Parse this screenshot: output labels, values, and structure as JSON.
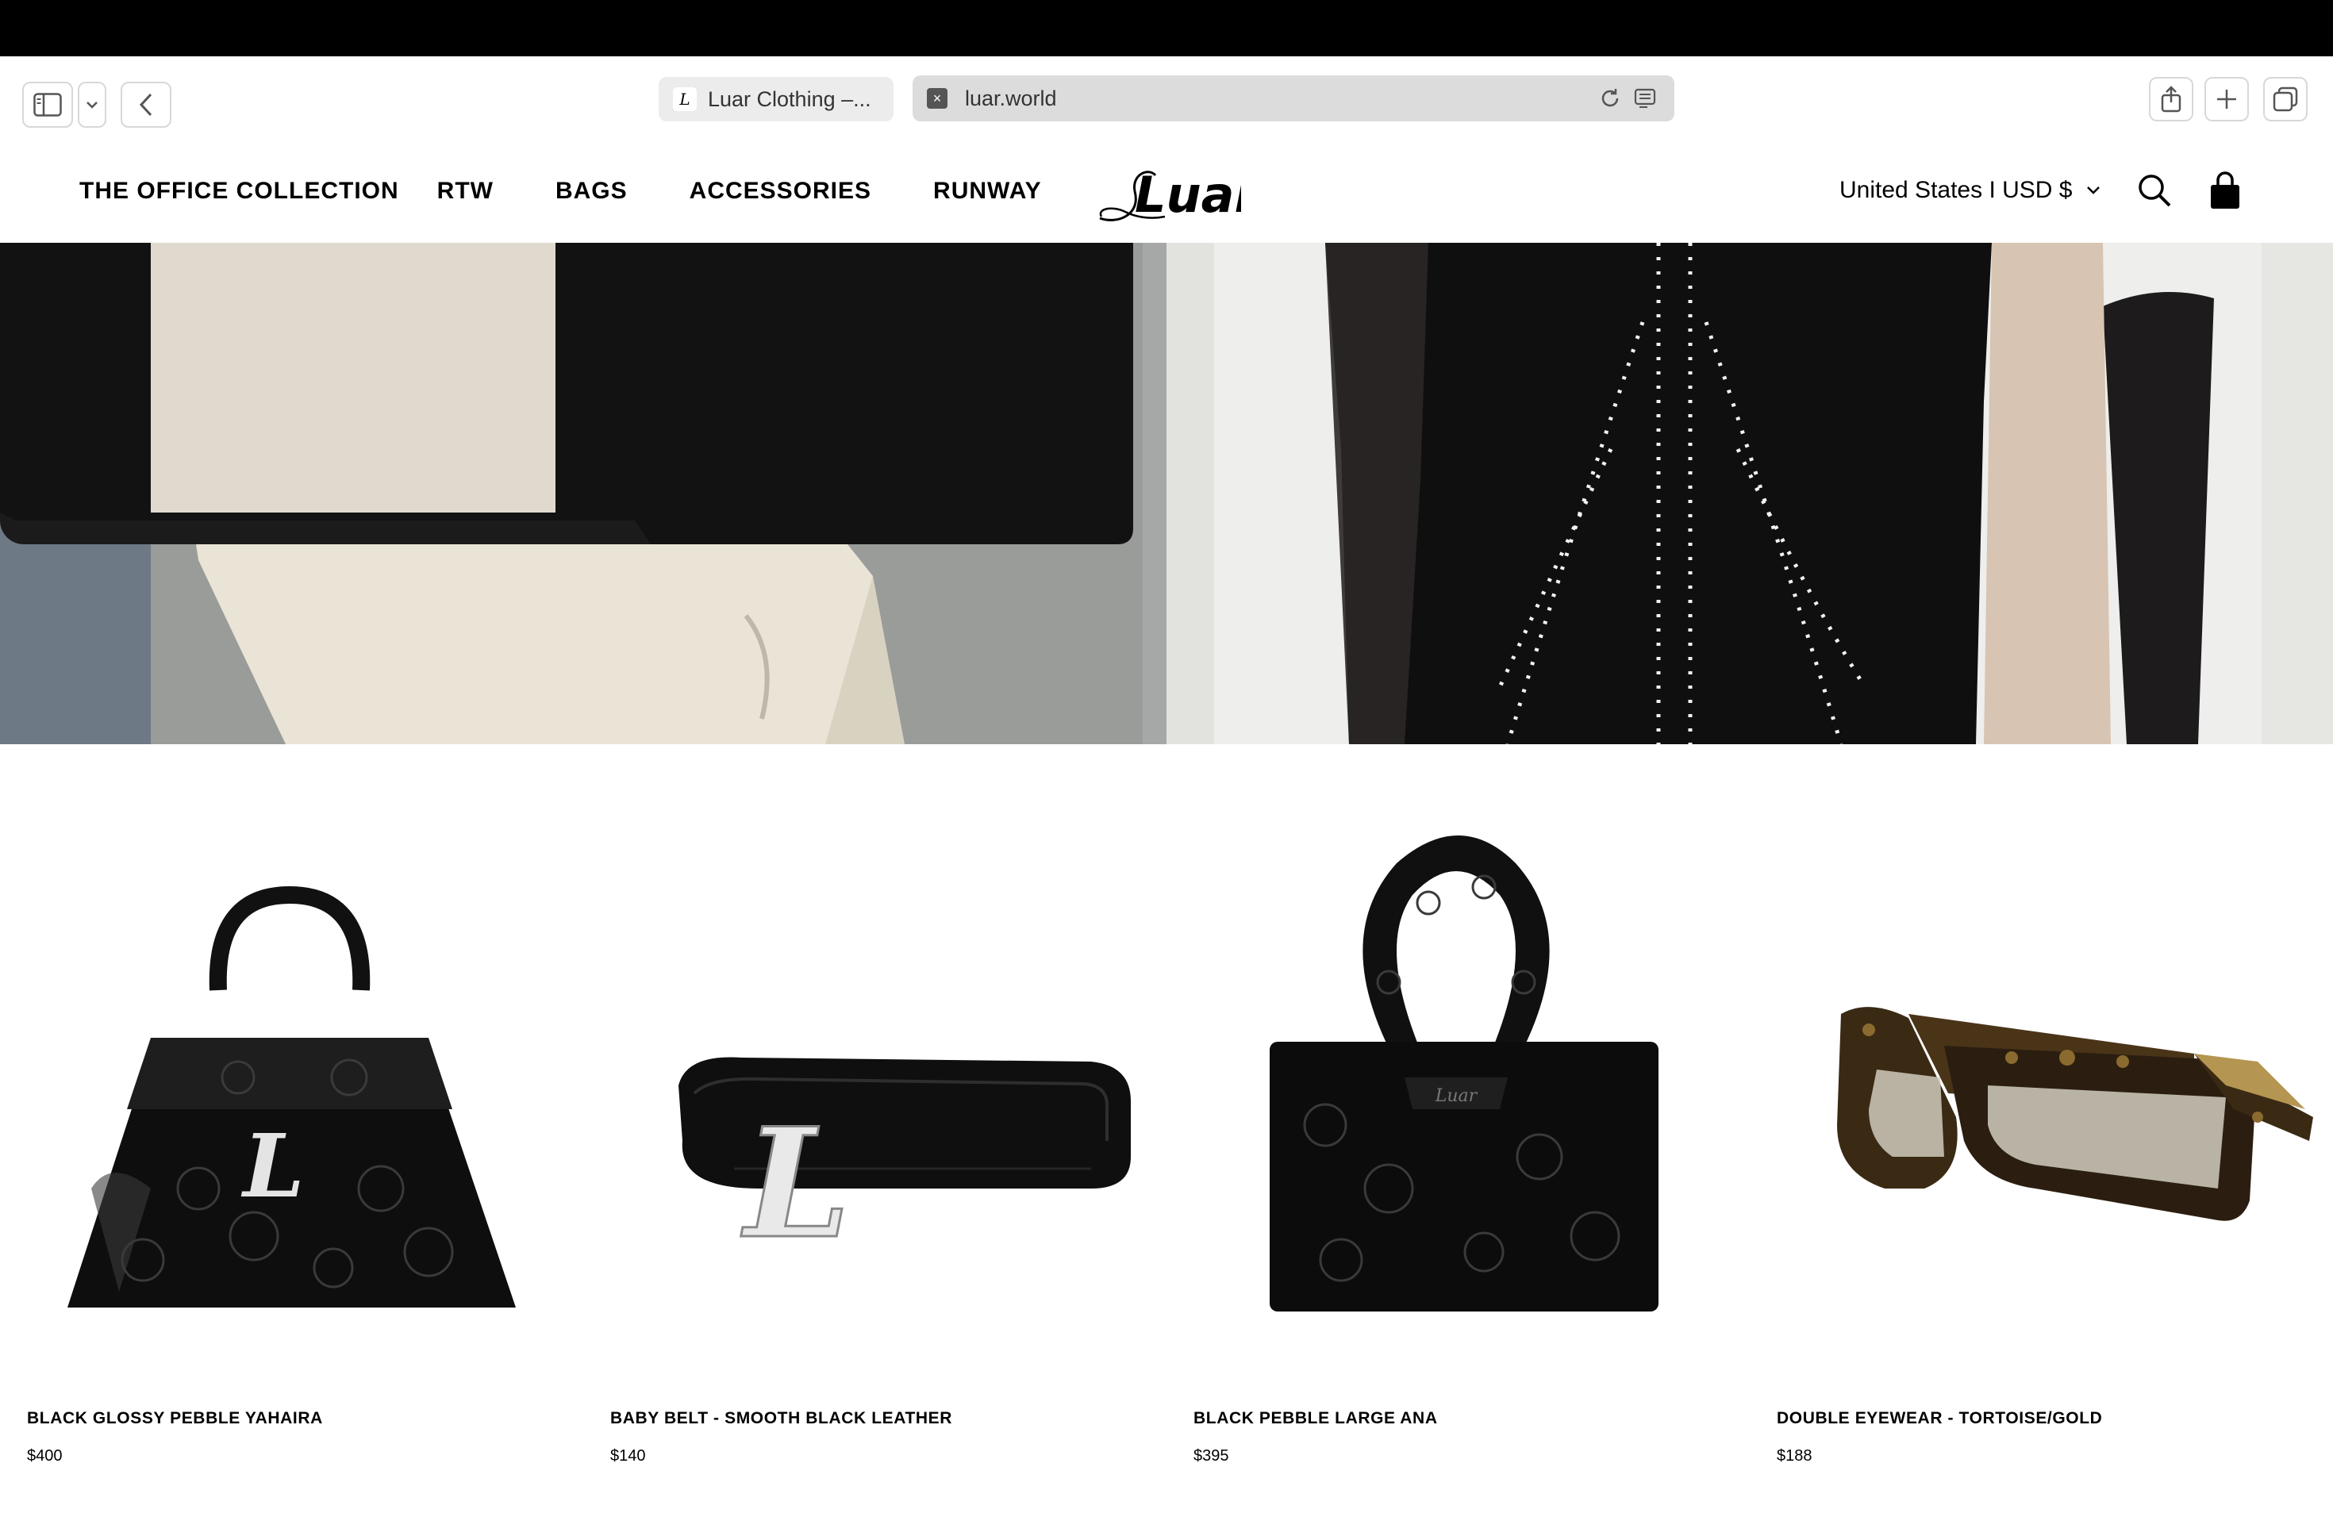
{
  "browser": {
    "tab_title": "Luar Clothing –...",
    "url": "luar.world"
  },
  "nav": {
    "items": [
      "THE OFFICE COLLECTION",
      "RTW",
      "BAGS",
      "ACCESSORIES",
      "RUNWAY"
    ],
    "logo_text": "Luar",
    "region": "United States I USD $"
  },
  "products": [
    {
      "name": "BLACK GLOSSY PEBBLE YAHAIRA",
      "price": "$400",
      "icon": "handbag-icon"
    },
    {
      "name": "BABY BELT - SMOOTH BLACK LEATHER",
      "price": "$140",
      "icon": "belt-icon"
    },
    {
      "name": "BLACK PEBBLE LARGE ANA",
      "price": "$395",
      "icon": "handbag-icon"
    },
    {
      "name": "DOUBLE EYEWEAR - TORTOISE/GOLD",
      "price": "$188",
      "icon": "sunglasses-icon"
    }
  ],
  "colors": {
    "menubar": "#000000",
    "url_bar": "#dcdcdc",
    "text": "#000000"
  }
}
